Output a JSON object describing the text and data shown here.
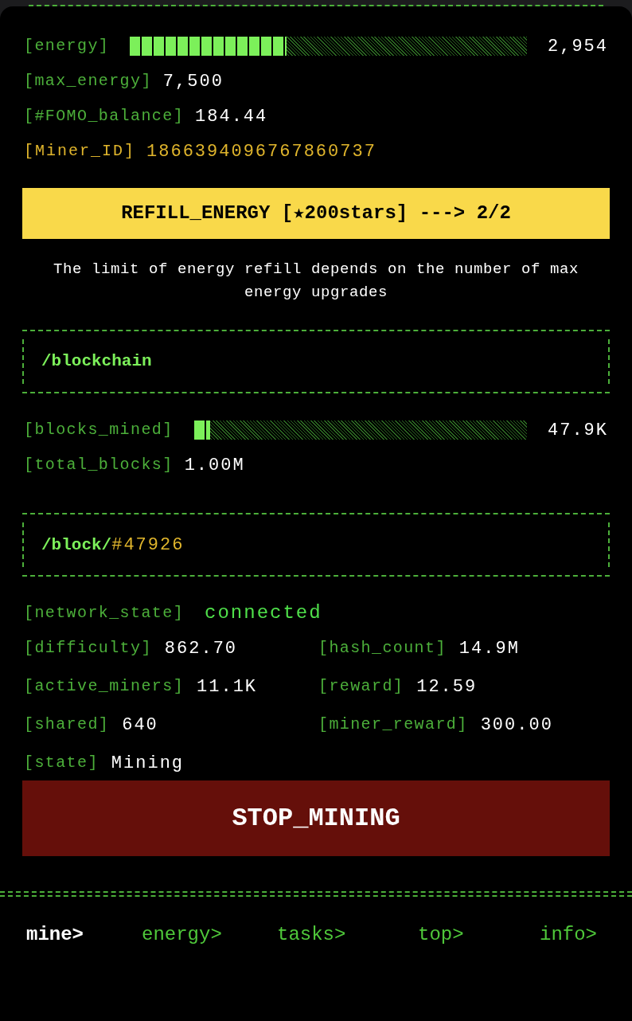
{
  "energy_rows": [
    {
      "kind": "meter",
      "label": "[energy]",
      "level": 0.394,
      "reading": "2,954"
    },
    {
      "kind": "value",
      "label": "[max_energy]",
      "value": "7,500"
    },
    {
      "kind": "value",
      "label": "[#FOMO_balance]",
      "value": "184.44"
    },
    {
      "kind": "id",
      "label": "[Miner_ID]",
      "value": "1866394096767860737"
    }
  ],
  "refill_button": "REFILL_ENERGY [★200stars] ---> 2/2",
  "refill_note": "The limit of energy refill depends on the number of max energy upgrades",
  "blockchain": {
    "title": "/blockchain",
    "rows": [
      {
        "kind": "meter",
        "label": "[blocks_mined]",
        "level": 0.048,
        "reading": "47.9K"
      },
      {
        "kind": "value",
        "label": "[total_blocks]",
        "value": "1.00M"
      }
    ]
  },
  "block": {
    "title": "/block/",
    "number": "#47926",
    "network_state": {
      "label": "[network_state]",
      "value": "connected"
    },
    "stats": [
      {
        "label": "[difficulty]",
        "value": "862.70"
      },
      {
        "label": "[hash_count]",
        "value": "14.9M"
      },
      {
        "label": "[active_miners]",
        "value": "11.1K"
      },
      {
        "label": "[reward]",
        "value": "12.59"
      },
      {
        "label": "[shared]",
        "value": "640"
      },
      {
        "label": "[miner_reward]",
        "value": "300.00"
      },
      {
        "label": "[state]",
        "value": "Mining"
      }
    ]
  },
  "stop_button": "STOP_MINING",
  "nav": [
    {
      "label": "mine>",
      "selected": true
    },
    {
      "label": "energy>",
      "selected": false
    },
    {
      "label": "tasks>",
      "selected": false
    },
    {
      "label": "top>",
      "selected": false
    },
    {
      "label": "info>",
      "selected": false
    }
  ]
}
